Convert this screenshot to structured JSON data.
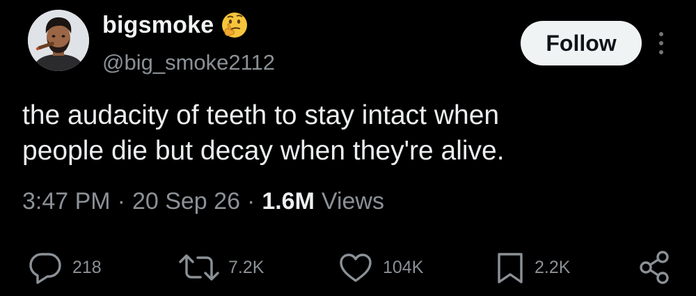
{
  "user": {
    "display_name": "bigsmoke",
    "emoji": "thinking-face-emoji",
    "handle": "@big_smoke2112"
  },
  "buttons": {
    "follow_label": "Follow",
    "more_icon": "vertical-ellipsis-icon"
  },
  "tweet": {
    "text": "the audacity of teeth to stay intact when\npeople die but decay when they're alive."
  },
  "meta": {
    "time": "3:47 PM",
    "separator": "·",
    "date": "20 Sep 26",
    "views_count": "1.6M",
    "views_label": "Views"
  },
  "actions": {
    "reply": {
      "icon": "reply-icon",
      "count": "218"
    },
    "retweet": {
      "icon": "retweet-icon",
      "count": "7.2K"
    },
    "like": {
      "icon": "heart-icon",
      "count": "104K"
    },
    "bookmark": {
      "icon": "bookmark-icon",
      "count": "2.2K"
    },
    "share": {
      "icon": "share-icon"
    }
  },
  "colors": {
    "background": "#000000",
    "primary_text": "#e7e9ea",
    "secondary_text": "#8b9196",
    "follow_button_bg": "#eff3f4",
    "follow_button_text": "#0f1419"
  }
}
